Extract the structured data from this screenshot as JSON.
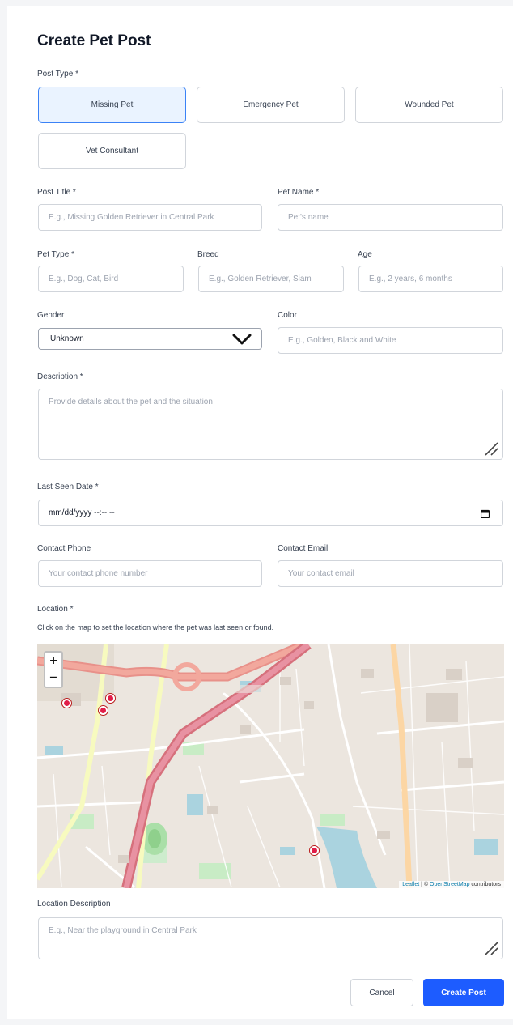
{
  "form": {
    "title": "Create Pet Post",
    "post_type": {
      "label": "Post Type *",
      "options": [
        "Missing Pet",
        "Emergency Pet",
        "Wounded Pet",
        "Vet Consultant"
      ],
      "selected": "Missing Pet"
    },
    "post_title": {
      "label": "Post Title *",
      "placeholder": "E.g., Missing Golden Retriever in Central Park"
    },
    "pet_name": {
      "label": "Pet Name *",
      "placeholder": "Pet's name"
    },
    "pet_type": {
      "label": "Pet Type *",
      "placeholder": "E.g., Dog, Cat, Bird"
    },
    "breed": {
      "label": "Breed",
      "placeholder": "E.g., Golden Retriever, Siam"
    },
    "age": {
      "label": "Age",
      "placeholder": "E.g., 2 years, 6 months"
    },
    "gender": {
      "label": "Gender",
      "value": "Unknown"
    },
    "color": {
      "label": "Color",
      "placeholder": "E.g., Golden, Black and White"
    },
    "description": {
      "label": "Description *",
      "placeholder": "Provide details about the pet and the situation"
    },
    "last_seen": {
      "label": "Last Seen Date *",
      "value": "mm/dd/yyyy --:-- --"
    },
    "contact_phone": {
      "label": "Contact Phone",
      "placeholder": "Your contact phone number"
    },
    "contact_email": {
      "label": "Contact Email",
      "placeholder": "Your contact email"
    },
    "location": {
      "label": "Location *",
      "helper": "Click on the map to set the location where the pet was last seen or found.",
      "zoom_in": "+",
      "zoom_out": "−",
      "attribution_leaflet": "Leaflet",
      "attribution_sep": " | © ",
      "attribution_osm": "OpenStreetMap",
      "attribution_tail": " contributors"
    },
    "location_description": {
      "label": "Location Description",
      "placeholder": "E.g., Near the playground in Central Park"
    },
    "cancel_label": "Cancel",
    "submit_label": "Create Post"
  },
  "colors": {
    "accent": "#1d5cff",
    "selected_bg": "#eaf3ff",
    "selected_border": "#3b82f6",
    "marker": "#e11d48"
  },
  "icons": {
    "select_arrow": "chevron-down-icon",
    "calendar": "calendar-icon",
    "resize": "resize-handle-icon",
    "marker": "map-marker-icon"
  }
}
